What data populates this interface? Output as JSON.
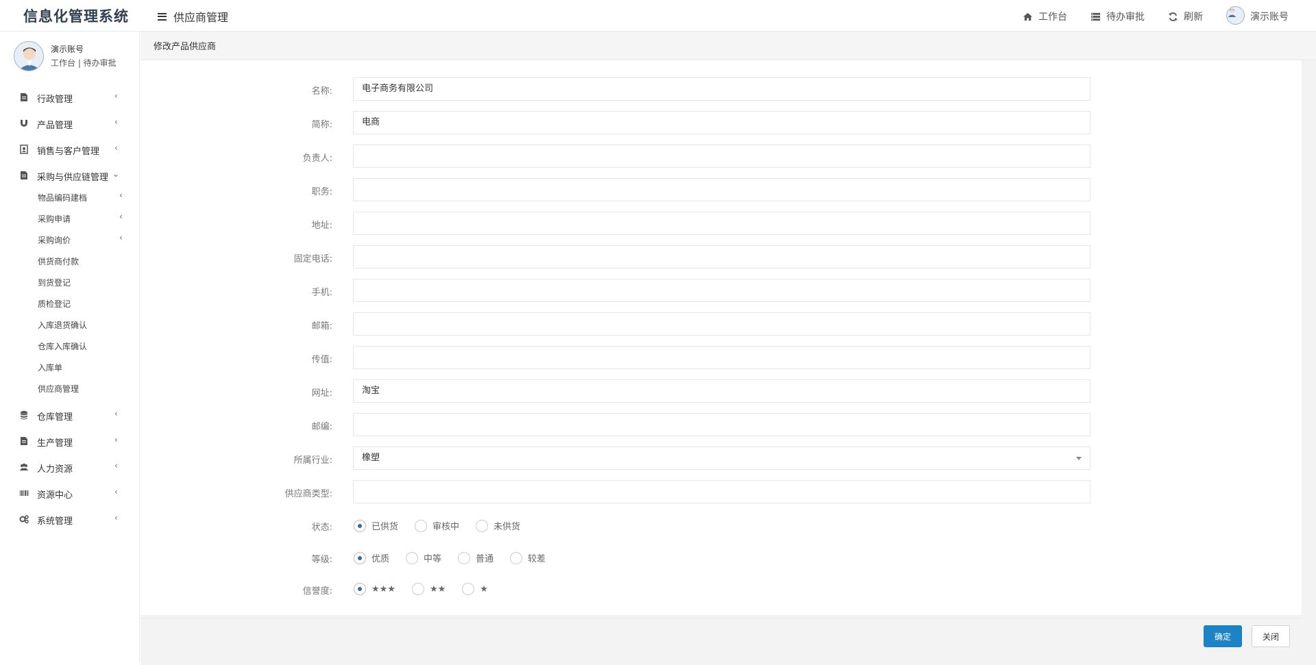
{
  "app": {
    "title": "信息化管理系统"
  },
  "header": {
    "menu_label": "供应商管理",
    "links": [
      {
        "label": "工作台",
        "icon": "home-icon"
      },
      {
        "label": "待办审批",
        "icon": "list-icon"
      },
      {
        "label": "刷新",
        "icon": "refresh-icon"
      },
      {
        "label": "演示账号",
        "icon": "avatar"
      }
    ]
  },
  "sidebar": {
    "user_name": "演示账号",
    "user_links": "工作台 | 待办审批",
    "items": [
      {
        "label": "行政管理",
        "icon": "file-icon",
        "arrow": "‹"
      },
      {
        "label": "产品管理",
        "icon": "magnet-icon",
        "arrow": "‹"
      },
      {
        "label": "销售与客户管理",
        "icon": "contact-icon",
        "arrow": "‹"
      },
      {
        "label": "采购与供应链管理",
        "icon": "file-icon",
        "arrow": "⌄"
      },
      {
        "label": "仓库管理",
        "icon": "database-icon",
        "arrow": "‹"
      },
      {
        "label": "生产管理",
        "icon": "file-icon",
        "arrow": "‹"
      },
      {
        "label": "人力资源",
        "icon": "users-icon",
        "arrow": "‹"
      },
      {
        "label": "资源中心",
        "icon": "barcode-icon",
        "arrow": "‹"
      },
      {
        "label": "系统管理",
        "icon": "gears-icon",
        "arrow": "‹"
      }
    ],
    "sub_items": [
      {
        "label": "物品编码建档",
        "arrow": "‹"
      },
      {
        "label": "采购申请",
        "arrow": "‹"
      },
      {
        "label": "采购询价",
        "arrow": "‹"
      },
      {
        "label": "供货商付款",
        "arrow": ""
      },
      {
        "label": "到货登记",
        "arrow": ""
      },
      {
        "label": "质检登记",
        "arrow": ""
      },
      {
        "label": "入库退货确认",
        "arrow": ""
      },
      {
        "label": "仓库入库确认",
        "arrow": ""
      },
      {
        "label": "入库单",
        "arrow": ""
      },
      {
        "label": "供应商管理",
        "arrow": ""
      }
    ]
  },
  "panel": {
    "title": "修改产品供应商"
  },
  "form": {
    "fields": [
      {
        "label": "名称:",
        "value": "电子商务有限公司"
      },
      {
        "label": "简称:",
        "value": "电商"
      },
      {
        "label": "负责人:",
        "value": ""
      },
      {
        "label": "职务:",
        "value": ""
      },
      {
        "label": "地址:",
        "value": ""
      },
      {
        "label": "固定电话:",
        "value": ""
      },
      {
        "label": "手机:",
        "value": ""
      },
      {
        "label": "邮箱:",
        "value": ""
      },
      {
        "label": "传值:",
        "value": ""
      },
      {
        "label": "网址:",
        "value": "淘宝"
      },
      {
        "label": "邮编:",
        "value": ""
      },
      {
        "label": "所属行业:",
        "value": "橡塑"
      },
      {
        "label": "供应商类型:",
        "value": ""
      }
    ],
    "status": {
      "label": "状态:",
      "options": [
        "已供货",
        "审核中",
        "未供货"
      ],
      "selected": 0
    },
    "grade": {
      "label": "等级:",
      "options": [
        "优质",
        "中等",
        "普通",
        "较差"
      ],
      "selected": 0
    },
    "credit": {
      "label": "信誉度:",
      "options": [
        "★★★",
        "★★",
        "★"
      ],
      "selected": 0
    }
  },
  "footer": {
    "confirm_label": "确定",
    "close_label": "关闭"
  },
  "colors": {
    "primary": "#1c84c6",
    "sidebar_text": "#333333",
    "logo": "#2f4050"
  }
}
